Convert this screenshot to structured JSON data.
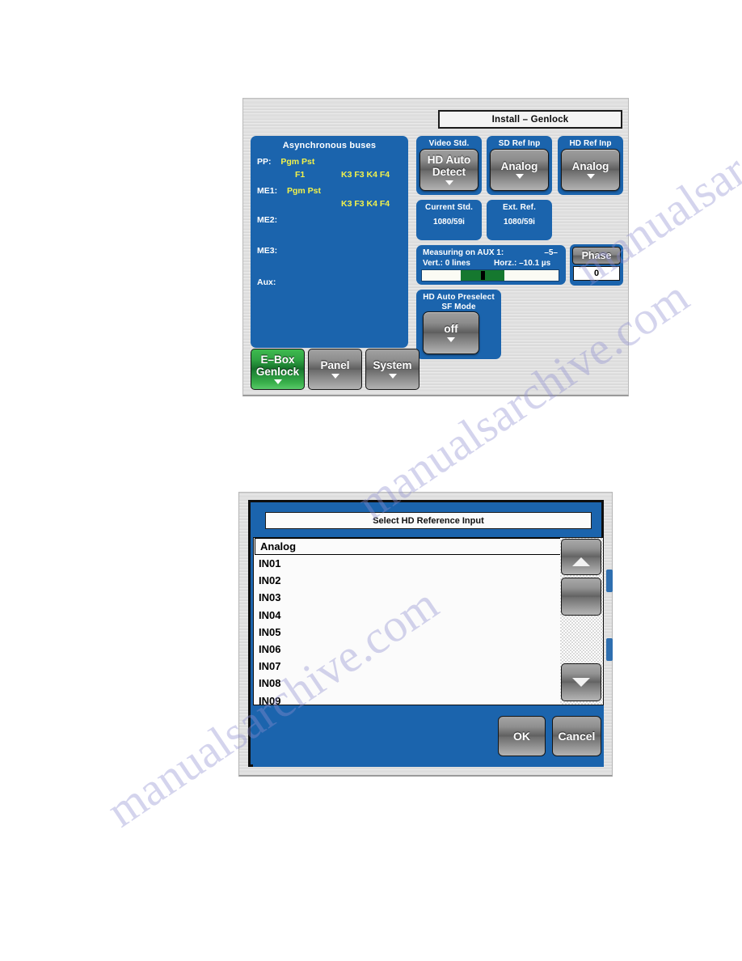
{
  "genlock_panel": {
    "title": "Install – Genlock",
    "async_buses": {
      "heading": "Asynchronous buses",
      "rows": [
        {
          "label": "PP:",
          "values": "Pgm    Pst"
        },
        {
          "label": "",
          "values": "F1"
        },
        {
          "label": "ME1:",
          "values": "Pgm    Pst"
        },
        {
          "label": "",
          "values": "K3  F3  K4  F4"
        },
        {
          "label": "ME2:",
          "values": ""
        },
        {
          "label": "ME3:",
          "values": ""
        },
        {
          "label": "Aux:",
          "values": ""
        }
      ],
      "pp_keys": "K3  F3  K4  F4",
      "me1_keys": "K3  F3  K4  F4",
      "pp_label": "PP:",
      "pp_busses": "Pgm    Pst",
      "pp_f1": "F1",
      "me1_label": "ME1:",
      "me1_busses": "Pgm    Pst",
      "me2_label": "ME2:",
      "me3_label": "ME3:",
      "aux_label": "Aux:"
    },
    "video_std": {
      "caption": "Video Std.",
      "value": "HD Auto Detect",
      "line1": "HD Auto",
      "line2": "Detect"
    },
    "sd_ref_inp": {
      "caption": "SD Ref Inp",
      "value": "Analog"
    },
    "hd_ref_inp": {
      "caption": "HD Ref Inp",
      "value": "Analog"
    },
    "current_std": {
      "caption": "Current Std.",
      "value": "1080/59i"
    },
    "ext_ref": {
      "caption": "Ext. Ref.",
      "value": "1080/59i"
    },
    "measuring": {
      "title": "Measuring on AUX 1:",
      "marker": "–5–",
      "vert": "Vert.:  0 lines",
      "horz": "Horz.:  –10.1 µs"
    },
    "phase": {
      "label": "Phase",
      "value": "0"
    },
    "preselect": {
      "caption1": "HD Auto Preselect",
      "caption2": "SF Mode",
      "value": "off"
    },
    "tabs": [
      {
        "name": "e-box-genlock",
        "line1": "E–Box",
        "line2": "Genlock",
        "active": true
      },
      {
        "name": "panel",
        "line1": "Panel",
        "line2": "",
        "active": false
      },
      {
        "name": "system",
        "line1": "System",
        "line2": "",
        "active": false
      }
    ],
    "colors": {
      "panel_blue": "#1b64ad",
      "active_green": "#2fa343",
      "meter_green": "#15782f",
      "value_yellow": "#f2f24b"
    }
  },
  "dialog_panel": {
    "title": "Select HD Reference Input",
    "list_items": [
      {
        "label": "Analog",
        "selected": true
      },
      {
        "label": "IN01",
        "selected": false
      },
      {
        "label": "IN02",
        "selected": false
      },
      {
        "label": "IN03",
        "selected": false
      },
      {
        "label": "IN04",
        "selected": false
      },
      {
        "label": "IN05",
        "selected": false
      },
      {
        "label": "IN06",
        "selected": false
      },
      {
        "label": "IN07",
        "selected": false
      },
      {
        "label": "IN08",
        "selected": false
      },
      {
        "label": "IN09",
        "selected": false
      }
    ],
    "scroll": {
      "up_icon": "triangle-up-icon",
      "down_icon": "triangle-down-icon"
    },
    "ok_label": "OK",
    "cancel_label": "Cancel"
  },
  "watermark": {
    "line1": "manualsarchive.com",
    "line2": "manualsarchive.com",
    "line3": "manualsarchive.com"
  }
}
